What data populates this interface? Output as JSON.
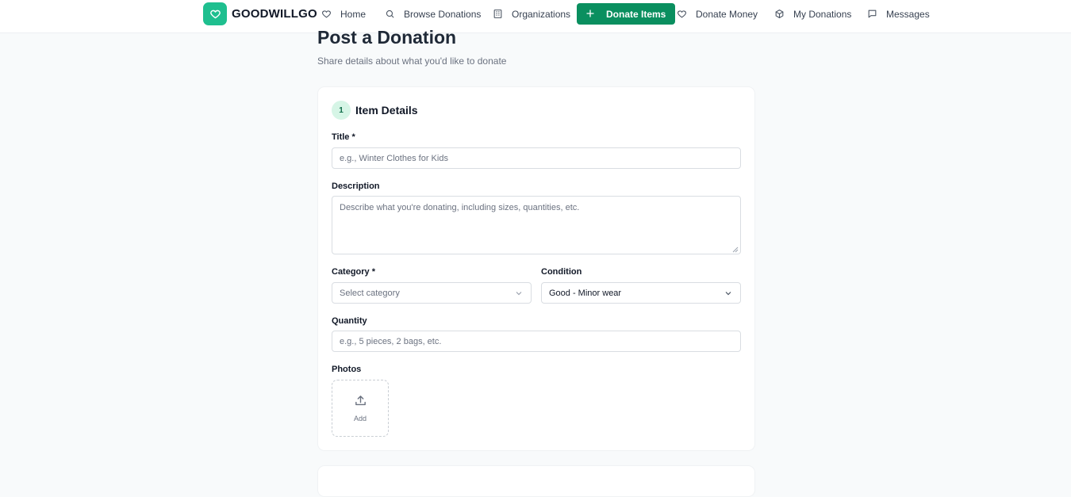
{
  "brand": {
    "name": "GOODWILLGO",
    "color": "#1fbf8f"
  },
  "nav": {
    "home": "Home",
    "browse": "Browse Donations",
    "organizations": "Organizations",
    "donate_items": "Donate Items",
    "donate_money": "Donate Money",
    "my_donations": "My Donations",
    "messages": "Messages",
    "primary_color": "#0a8f5f"
  },
  "page": {
    "title": "Post a Donation",
    "subtitle": "Share details about what you'd like to donate"
  },
  "section": {
    "step": "1",
    "title": "Item Details"
  },
  "form": {
    "title_label": "Title *",
    "title_placeholder": "e.g., Winter Clothes for Kids",
    "description_label": "Description",
    "description_placeholder": "Describe what you're donating, including sizes, quantities, etc.",
    "category_label": "Category *",
    "category_value": "Select category",
    "condition_label": "Condition",
    "condition_value": "Good - Minor wear",
    "quantity_label": "Quantity",
    "quantity_placeholder": "e.g., 5 pieces, 2 bags, etc.",
    "photos_label": "Photos",
    "add_label": "Add"
  }
}
